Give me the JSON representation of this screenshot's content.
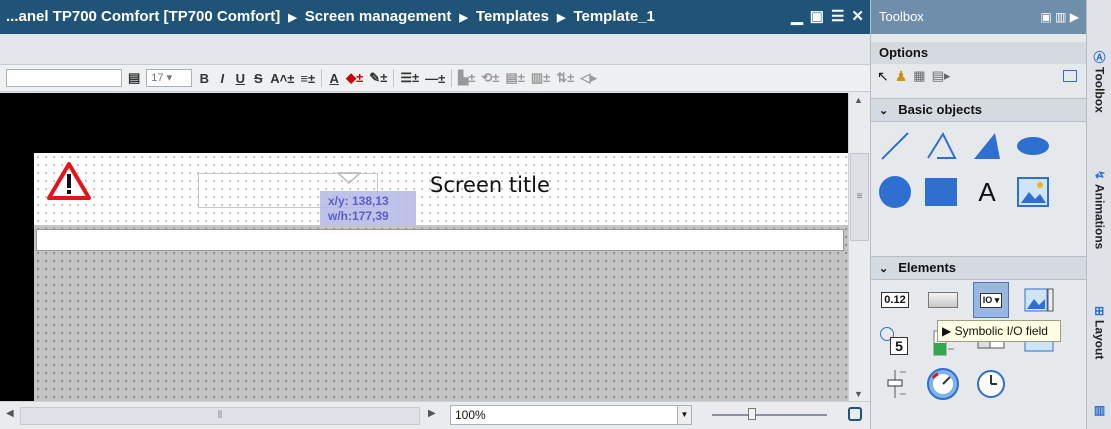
{
  "editor": {
    "breadcrumb": [
      "...anel TP700 Comfort [TP700 Comfort]",
      "Screen management",
      "Templates",
      "Template_1"
    ],
    "separator": "▶",
    "window_buttons": [
      "▁",
      "▣",
      "☰",
      "✕"
    ]
  },
  "toolbar": {
    "font_size": "17",
    "buttons": [
      "B",
      "I",
      "U",
      "S",
      "A"
    ]
  },
  "canvas": {
    "screen_title": "Screen title",
    "coords_xy": "x/y: 138,13",
    "coords_wh": "w/h:177,39"
  },
  "statusbar": {
    "zoom": "100%"
  },
  "toolbox": {
    "title": "Toolbox",
    "options_label": "Options",
    "sections": {
      "basic_objects": "Basic objects",
      "elements": "Elements"
    },
    "tooltip": "Symbolic I/O field",
    "elements_io_label": "0.12",
    "clock_number": "5",
    "text_tool": "A"
  },
  "side_tabs": [
    "Toolbox",
    "Animations",
    "Layout"
  ],
  "colors": {
    "titlebar": "#1f5478",
    "toolbox_header": "#6f8ea9",
    "selection": "#9ab7e0",
    "accent_blue": "#2f6fd0"
  }
}
